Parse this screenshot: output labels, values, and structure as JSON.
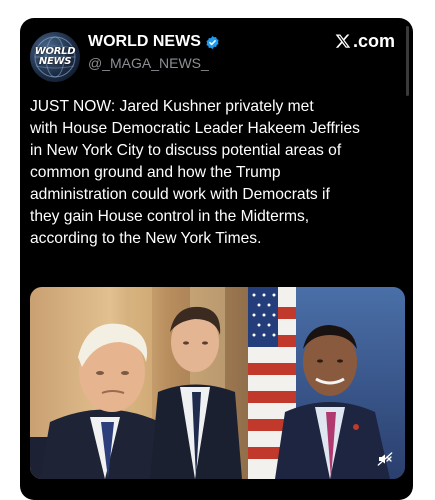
{
  "account": {
    "display_name": "WORLD NEWS",
    "handle": "@_MAGA_NEWS_",
    "avatar_text_line1": "WORLD",
    "avatar_text_line2": "NEWS"
  },
  "source_label": ".com",
  "tweet": {
    "text": "JUST NOW: Jared Kushner privately met\nwith House Democratic Leader Hakeem Jeffries\nin New York City to discuss potential areas of\ncommon ground and how the Trump\nadministration could work with Democrats if\nthey gain House control in the Midterms,\naccording to the New York Times."
  },
  "icons": {
    "verified": "verified-badge-icon",
    "x_logo": "x-logo-icon",
    "mute": "muted-speaker-icon"
  },
  "colors": {
    "card_background": "#000000",
    "text_primary": "#ffffff",
    "text_secondary": "#8b8f94",
    "verified_blue": "#1d9bf0"
  }
}
